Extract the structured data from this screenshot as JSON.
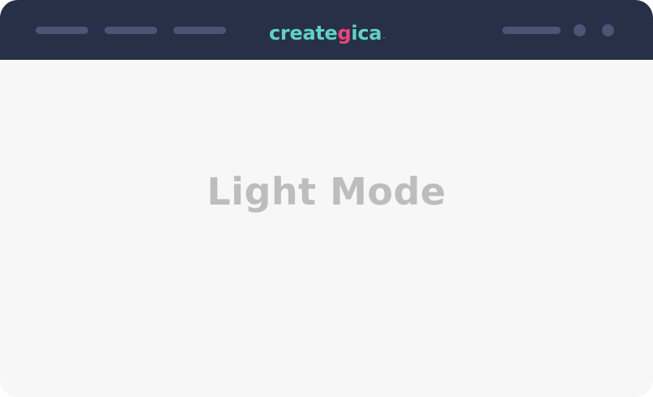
{
  "browser": {
    "logo": {
      "part1": "create",
      "accent": "g",
      "part2": "ica",
      "tm": "™"
    }
  },
  "content": {
    "headline": "Light Mode"
  },
  "colors": {
    "topbar": "#273047",
    "placeholder": "#4b5677",
    "logo_teal": "#5fd3c3",
    "logo_pink": "#e8457a",
    "page_background": "#f7f7f7",
    "headline": "#bdbdbd"
  }
}
